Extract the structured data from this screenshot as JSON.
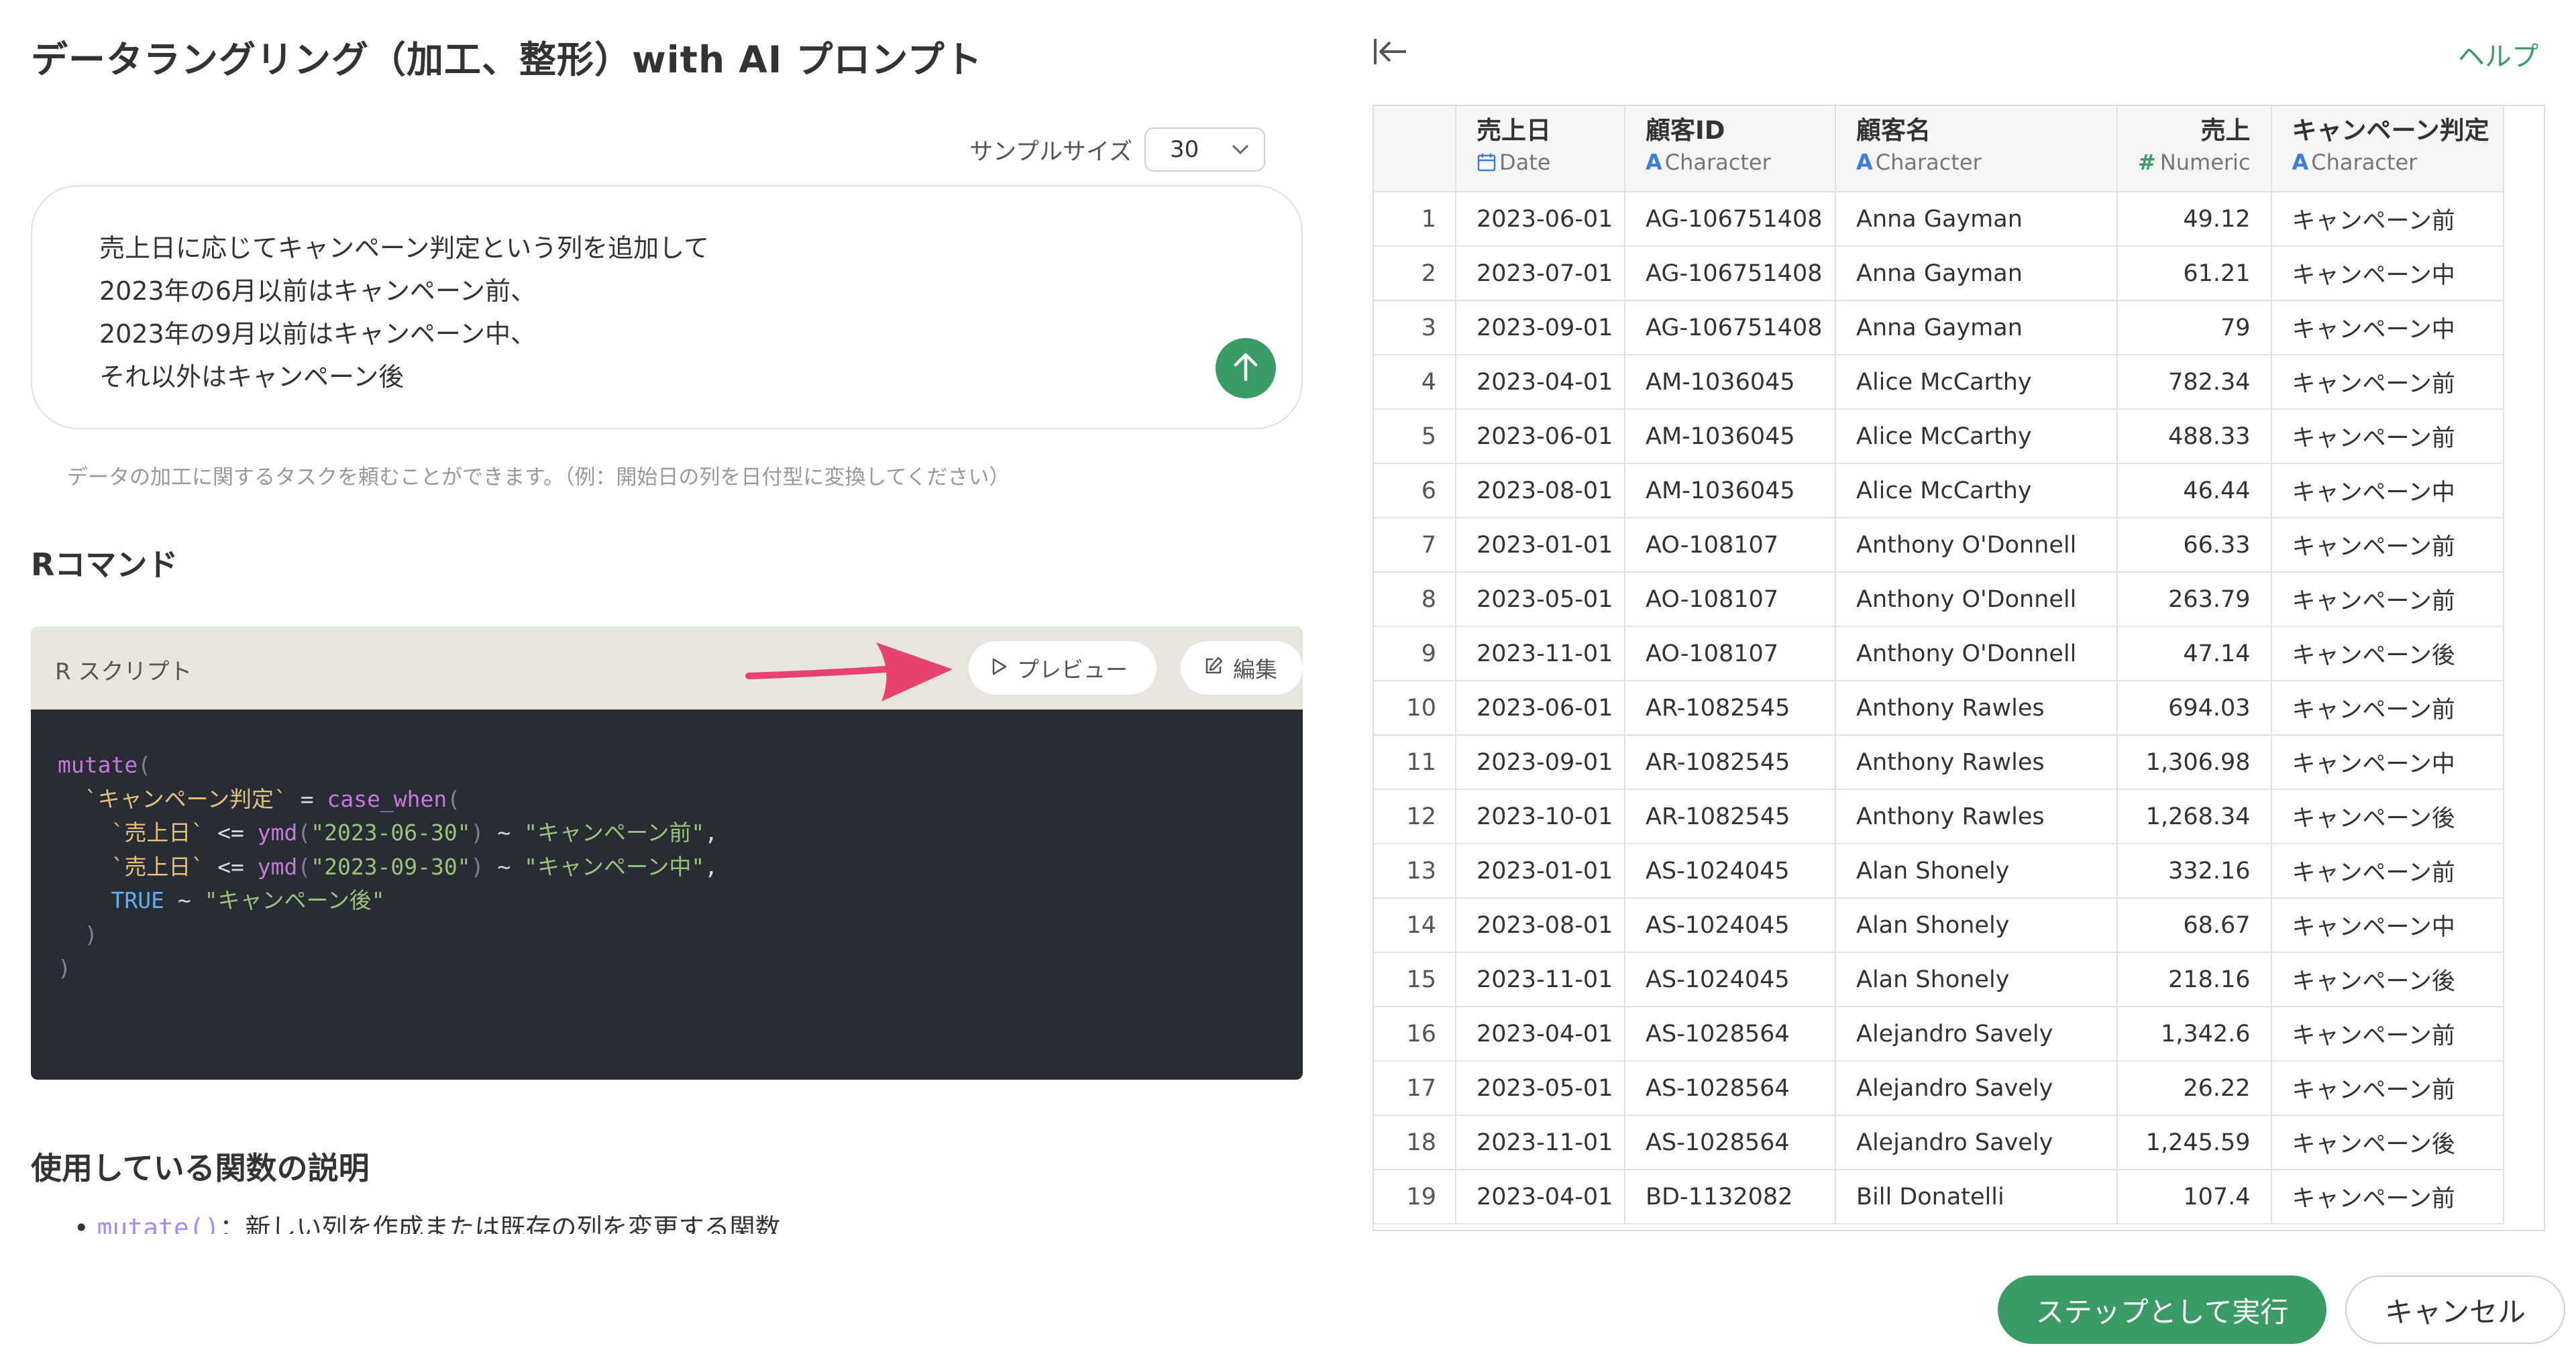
{
  "header": {
    "title": "データラングリング（加工、整形）with AI プロンプト"
  },
  "sample": {
    "label": "サンプルサイズ",
    "value": "30"
  },
  "prompt": {
    "text": "売上日に応じてキャンペーン判定という列を追加して\n2023年の6月以前はキャンペーン前、\n2023年の9月以前はキャンペーン中、\nそれ以外はキャンペーン後",
    "hint": "データの加工に関するタスクを頼むことができます。（例：開始日の列を日付型に変換してください）"
  },
  "rcommand": {
    "title": "Rコマンド",
    "script_label": "R スクリプト",
    "preview_label": "プレビュー",
    "edit_label": "編集",
    "code": {
      "l1_fn": "mutate",
      "l2_col": "`キャンペーン判定`",
      "l2_fn": "case_when",
      "date_col": "`売上日`",
      "ymd_fn": "ymd",
      "d1": "\"2023-06-30\"",
      "v1": "\"キャンペーン前\"",
      "d2": "\"2023-09-30\"",
      "v2": "\"キャンペーン中\"",
      "true_kw": "TRUE",
      "v3": "\"キャンペーン後\""
    }
  },
  "functions": {
    "title": "使用している関数の説明",
    "first_code": "mutate()",
    "first_desc": "：新しい列を作成または既存の列を変更する関数"
  },
  "help": {
    "label": "ヘルプ"
  },
  "table": {
    "columns": [
      {
        "name": "売上日",
        "type": "Date",
        "icon": "calendar-icon"
      },
      {
        "name": "顧客ID",
        "type": "Character",
        "icon": "A"
      },
      {
        "name": "顧客名",
        "type": "Character",
        "icon": "A"
      },
      {
        "name": "売上",
        "type": "Numeric",
        "icon": "#"
      },
      {
        "name": "キャンペーン判定",
        "type": "Character",
        "icon": "A"
      }
    ],
    "rows": [
      [
        "1",
        "2023-06-01",
        "AG-106751408",
        "Anna Gayman",
        "49.12",
        "キャンペーン前"
      ],
      [
        "2",
        "2023-07-01",
        "AG-106751408",
        "Anna Gayman",
        "61.21",
        "キャンペーン中"
      ],
      [
        "3",
        "2023-09-01",
        "AG-106751408",
        "Anna Gayman",
        "79",
        "キャンペーン中"
      ],
      [
        "4",
        "2023-04-01",
        "AM-1036045",
        "Alice McCarthy",
        "782.34",
        "キャンペーン前"
      ],
      [
        "5",
        "2023-06-01",
        "AM-1036045",
        "Alice McCarthy",
        "488.33",
        "キャンペーン前"
      ],
      [
        "6",
        "2023-08-01",
        "AM-1036045",
        "Alice McCarthy",
        "46.44",
        "キャンペーン中"
      ],
      [
        "7",
        "2023-01-01",
        "AO-108107",
        "Anthony O'Donnell",
        "66.33",
        "キャンペーン前"
      ],
      [
        "8",
        "2023-05-01",
        "AO-108107",
        "Anthony O'Donnell",
        "263.79",
        "キャンペーン前"
      ],
      [
        "9",
        "2023-11-01",
        "AO-108107",
        "Anthony O'Donnell",
        "47.14",
        "キャンペーン後"
      ],
      [
        "10",
        "2023-06-01",
        "AR-1082545",
        "Anthony Rawles",
        "694.03",
        "キャンペーン前"
      ],
      [
        "11",
        "2023-09-01",
        "AR-1082545",
        "Anthony Rawles",
        "1,306.98",
        "キャンペーン中"
      ],
      [
        "12",
        "2023-10-01",
        "AR-1082545",
        "Anthony Rawles",
        "1,268.34",
        "キャンペーン後"
      ],
      [
        "13",
        "2023-01-01",
        "AS-1024045",
        "Alan Shonely",
        "332.16",
        "キャンペーン前"
      ],
      [
        "14",
        "2023-08-01",
        "AS-1024045",
        "Alan Shonely",
        "68.67",
        "キャンペーン中"
      ],
      [
        "15",
        "2023-11-01",
        "AS-1024045",
        "Alan Shonely",
        "218.16",
        "キャンペーン後"
      ],
      [
        "16",
        "2023-04-01",
        "AS-1028564",
        "Alejandro Savely",
        "1,342.6",
        "キャンペーン前"
      ],
      [
        "17",
        "2023-05-01",
        "AS-1028564",
        "Alejandro Savely",
        "26.22",
        "キャンペーン前"
      ],
      [
        "18",
        "2023-11-01",
        "AS-1028564",
        "Alejandro Savely",
        "1,245.59",
        "キャンペーン後"
      ],
      [
        "19",
        "2023-04-01",
        "BD-1132082",
        "Bill Donatelli",
        "107.4",
        "キャンペーン前"
      ]
    ]
  },
  "footer": {
    "run_label": "ステップとして実行",
    "cancel_label": "キャンセル"
  },
  "colors": {
    "accent": "#3a9b67",
    "arrow": "#e8426e",
    "code_bg": "#282c34",
    "code_header": "#e8e6dc",
    "type_icon": "#3b7dd8"
  }
}
